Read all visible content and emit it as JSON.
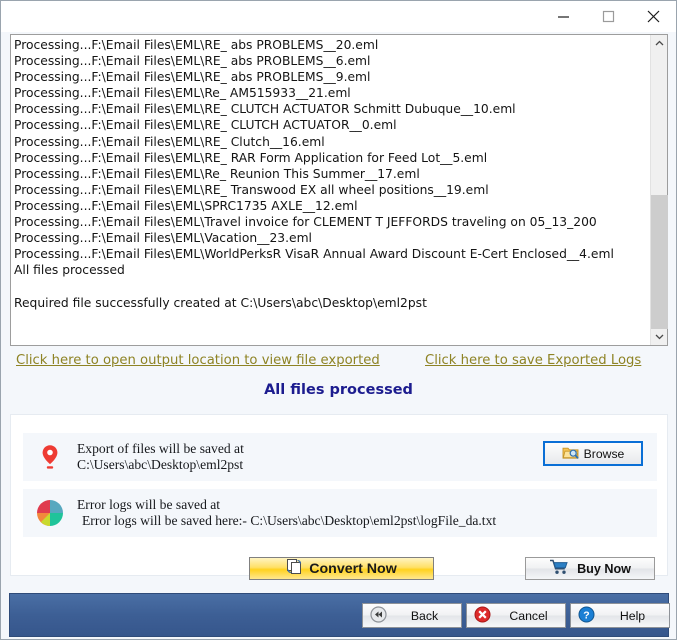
{
  "window": {
    "controls": {
      "minimize": "minimize-icon",
      "maximize": "maximize-icon",
      "close": "close-icon"
    }
  },
  "log": {
    "lines": [
      "Processing...F:\\Email Files\\EML\\RE_ abs PROBLEMS__20.eml",
      "Processing...F:\\Email Files\\EML\\RE_ abs PROBLEMS__6.eml",
      "Processing...F:\\Email Files\\EML\\RE_ abs PROBLEMS__9.eml",
      "Processing...F:\\Email Files\\EML\\Re_ AM515933__21.eml",
      "Processing...F:\\Email Files\\EML\\RE_ CLUTCH ACTUATOR Schmitt Dubuque__10.eml",
      "Processing...F:\\Email Files\\EML\\RE_ CLUTCH ACTUATOR__0.eml",
      "Processing...F:\\Email Files\\EML\\RE_ Clutch__16.eml",
      "Processing...F:\\Email Files\\EML\\RE_ RAR Form Application for Feed Lot__5.eml",
      "Processing...F:\\Email Files\\EML\\Re_ Reunion This Summer__17.eml",
      "Processing...F:\\Email Files\\EML\\RE_ Transwood EX all wheel positions__19.eml",
      "Processing...F:\\Email Files\\EML\\SPRC1735 AXLE__12.eml",
      "Processing...F:\\Email Files\\EML\\Travel invoice for CLEMENT T JEFFORDS traveling on 05_13_200",
      "Processing...F:\\Email Files\\EML\\Vacation__23.eml",
      "Processing...F:\\Email Files\\EML\\WorldPerksR VisaR Annual Award Discount E-Cert Enclosed__4.eml",
      "All files processed",
      "",
      "Required file successfully created at C:\\Users\\abc\\Desktop\\eml2pst"
    ]
  },
  "links": {
    "open_output": "Click here to open output location to view file exported",
    "save_logs": "Click here to save Exported Logs"
  },
  "status": {
    "text": "All files processed",
    "color": "#1c1c8f"
  },
  "export_row": {
    "icon": "location-pin-icon",
    "line1": "Export of files will be saved at",
    "line2": "C:\\Users\\abc\\Desktop\\eml2pst",
    "browse_label": "Browse",
    "browse_icon": "folder-search-icon"
  },
  "error_row": {
    "icon": "pie-chart-icon",
    "line1": "Error logs will be saved at",
    "line2": "Error logs will be saved here:- C:\\Users\\abc\\Desktop\\eml2pst\\logFile_da.txt"
  },
  "actions": {
    "convert_label": "Convert Now",
    "convert_icon": "copy-files-icon",
    "buy_label": "Buy Now",
    "buy_icon": "shopping-cart-icon"
  },
  "footer": {
    "back_label": "Back",
    "back_icon": "rewind-icon",
    "cancel_label": "Cancel",
    "cancel_icon": "error-x-icon",
    "help_label": "Help",
    "help_icon": "question-mark-icon"
  },
  "colors": {
    "link": "#8e8324",
    "status": "#1c1c8f",
    "footer_bar": "#3d5f95",
    "convert_yellow": "#ffd21f",
    "accent_blue": "#0a6fd6"
  }
}
